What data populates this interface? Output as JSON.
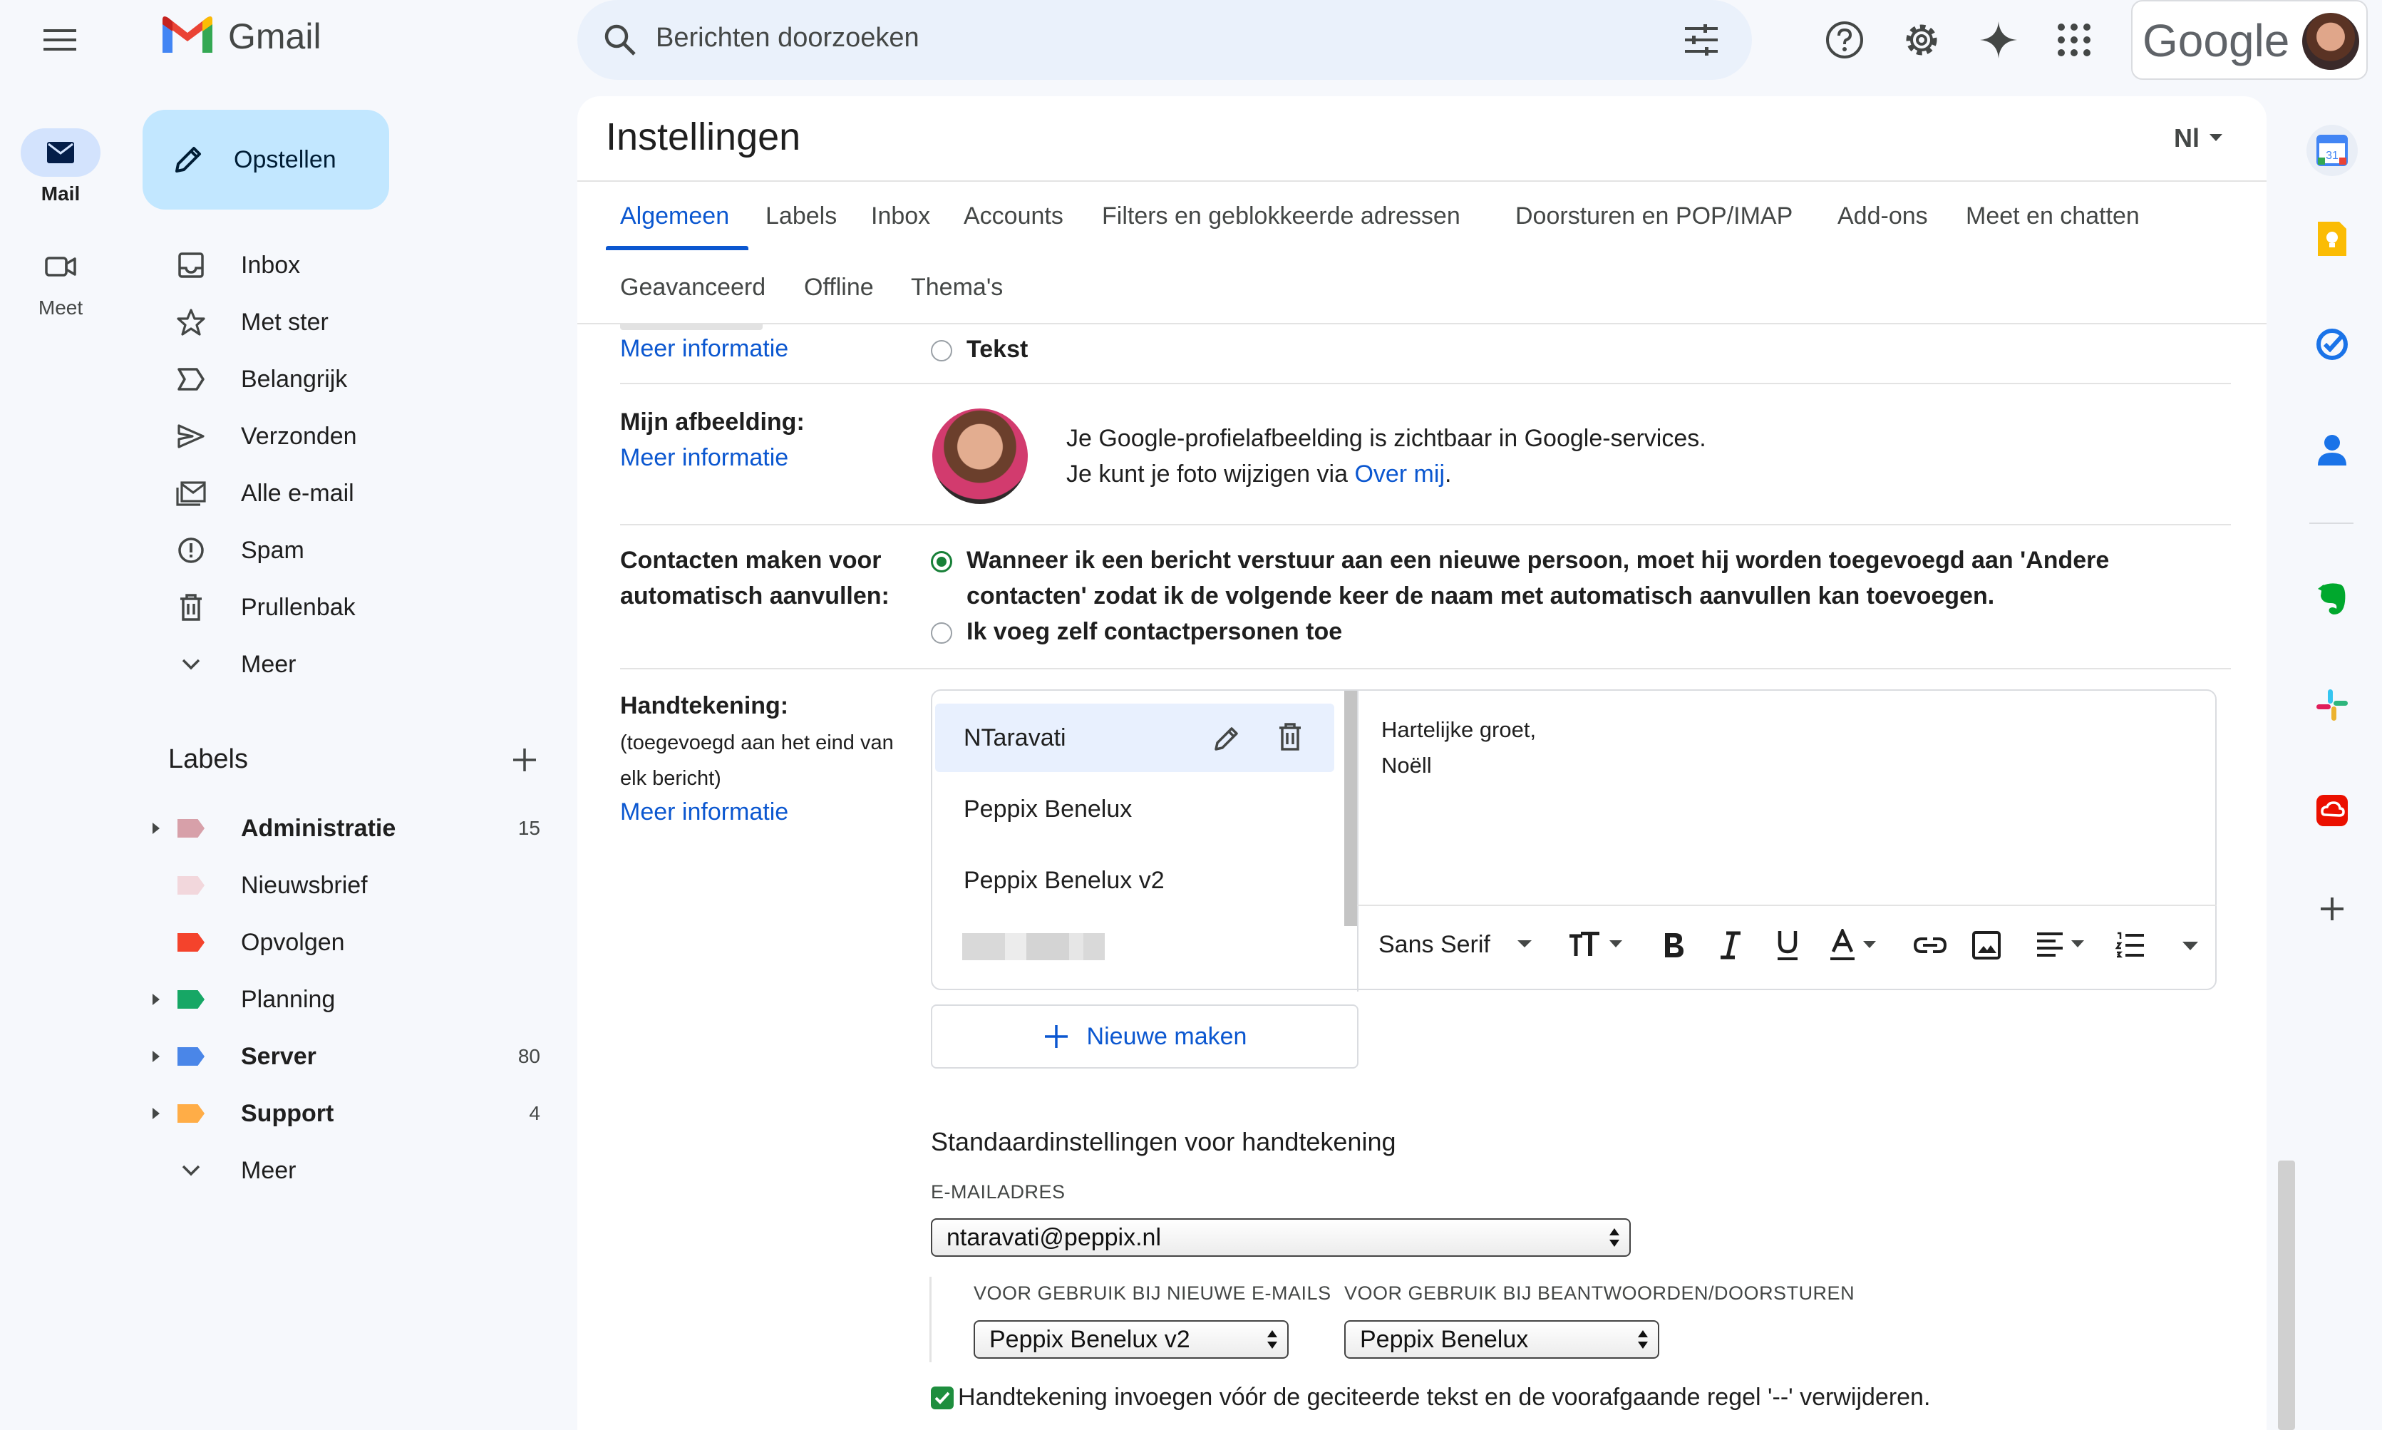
{
  "app": {
    "name": "Gmail",
    "brand_word": "Google"
  },
  "colors": {
    "accent": "#0b57d0",
    "compose_bg": "#c2e7ff",
    "rail_active": "#d3e3fd",
    "radio_on": "#188038"
  },
  "search": {
    "placeholder": "Berichten doorzoeken"
  },
  "rail": {
    "mail": "Mail",
    "meet": "Meet"
  },
  "compose": {
    "label": "Opstellen"
  },
  "nav": {
    "items": [
      {
        "label": "Inbox",
        "icon": "inbox-icon"
      },
      {
        "label": "Met ster",
        "icon": "star-icon"
      },
      {
        "label": "Belangrijk",
        "icon": "important-icon"
      },
      {
        "label": "Verzonden",
        "icon": "send-icon"
      },
      {
        "label": "Alle e-mail",
        "icon": "all-mail-icon"
      },
      {
        "label": "Spam",
        "icon": "spam-icon"
      },
      {
        "label": "Prullenbak",
        "icon": "trash-icon"
      },
      {
        "label": "Meer",
        "icon": "chevron-down-icon"
      }
    ]
  },
  "labels": {
    "heading": "Labels",
    "items": [
      {
        "name": "Administratie",
        "count": "15",
        "color": "#d7a0a9",
        "bold": true,
        "expandable": true
      },
      {
        "name": "Nieuwsbrief",
        "count": "",
        "color": "#f2d7dc",
        "bold": false,
        "expandable": false
      },
      {
        "name": "Opvolgen",
        "count": "",
        "color": "#f4432c",
        "bold": false,
        "expandable": false
      },
      {
        "name": "Planning",
        "count": "",
        "color": "#16a765",
        "bold": false,
        "expandable": true
      },
      {
        "name": "Server",
        "count": "80",
        "color": "#4a86e8",
        "bold": true,
        "expandable": true
      },
      {
        "name": "Support",
        "count": "4",
        "color": "#ffad47",
        "bold": true,
        "expandable": true
      }
    ],
    "more": "Meer"
  },
  "settings": {
    "title": "Instellingen",
    "language_indicator": "Nl",
    "tabs_row1": [
      "Algemeen",
      "Labels",
      "Inbox",
      "Accounts",
      "Filters en geblokkeerde adressen",
      "Doorsturen en POP/IMAP",
      "Add-ons",
      "Meet en chatten"
    ],
    "tabs_row2": [
      "Geavanceerd",
      "Offline",
      "Thema's"
    ],
    "active_tab": "Algemeen"
  },
  "buttons_section": {
    "more_info": "Meer informatie",
    "text_option": "Tekst"
  },
  "picture": {
    "label": "Mijn afbeelding:",
    "more_info": "Meer informatie",
    "line1": "Je Google-profielafbeelding is zichtbaar in Google-services.",
    "line2_prefix": "Je kunt je foto wijzigen via ",
    "line2_link": "Over mij",
    "line2_suffix": "."
  },
  "contacts": {
    "label_line1": "Contacten maken voor",
    "label_line2": "automatisch aanvullen:",
    "option1_line1": "Wanneer ik een bericht verstuur aan een nieuwe persoon, moet hij worden toegevoegd aan 'Andere",
    "option1_line2": "contacten' zodat ik de volgende keer de naam met automatisch aanvullen kan toevoegen.",
    "option2": "Ik voeg zelf contactpersonen toe",
    "selected": 1
  },
  "signature": {
    "label": "Handtekening:",
    "sub_line1": "(toegevoegd aan het eind van",
    "sub_line2": "elk bericht)",
    "more_info": "Meer informatie",
    "list": [
      "NTaravati",
      "Peppix Benelux",
      "Peppix Benelux v2"
    ],
    "selected_index": 0,
    "body_line1": "Hartelijke groet,",
    "body_line2": "Noëll",
    "font": "Sans Serif",
    "new_button": "Nieuwe maken"
  },
  "defaults": {
    "heading": "Standaardinstellingen voor handtekening",
    "email_label": "E-MAILADRES",
    "email_value": "ntaravati@peppix.nl",
    "new_label": "VOOR GEBRUIK BIJ NIEUWE E-MAILS",
    "new_value": "Peppix Benelux v2",
    "reply_label": "VOOR GEBRUIK BIJ BEANTWOORDEN/DOORSTUREN",
    "reply_value": "Peppix Benelux",
    "insert_text": "Handtekening invoegen vóór de geciteerde tekst en de voorafgaande regel '--' verwijderen.",
    "insert_checked": true
  }
}
